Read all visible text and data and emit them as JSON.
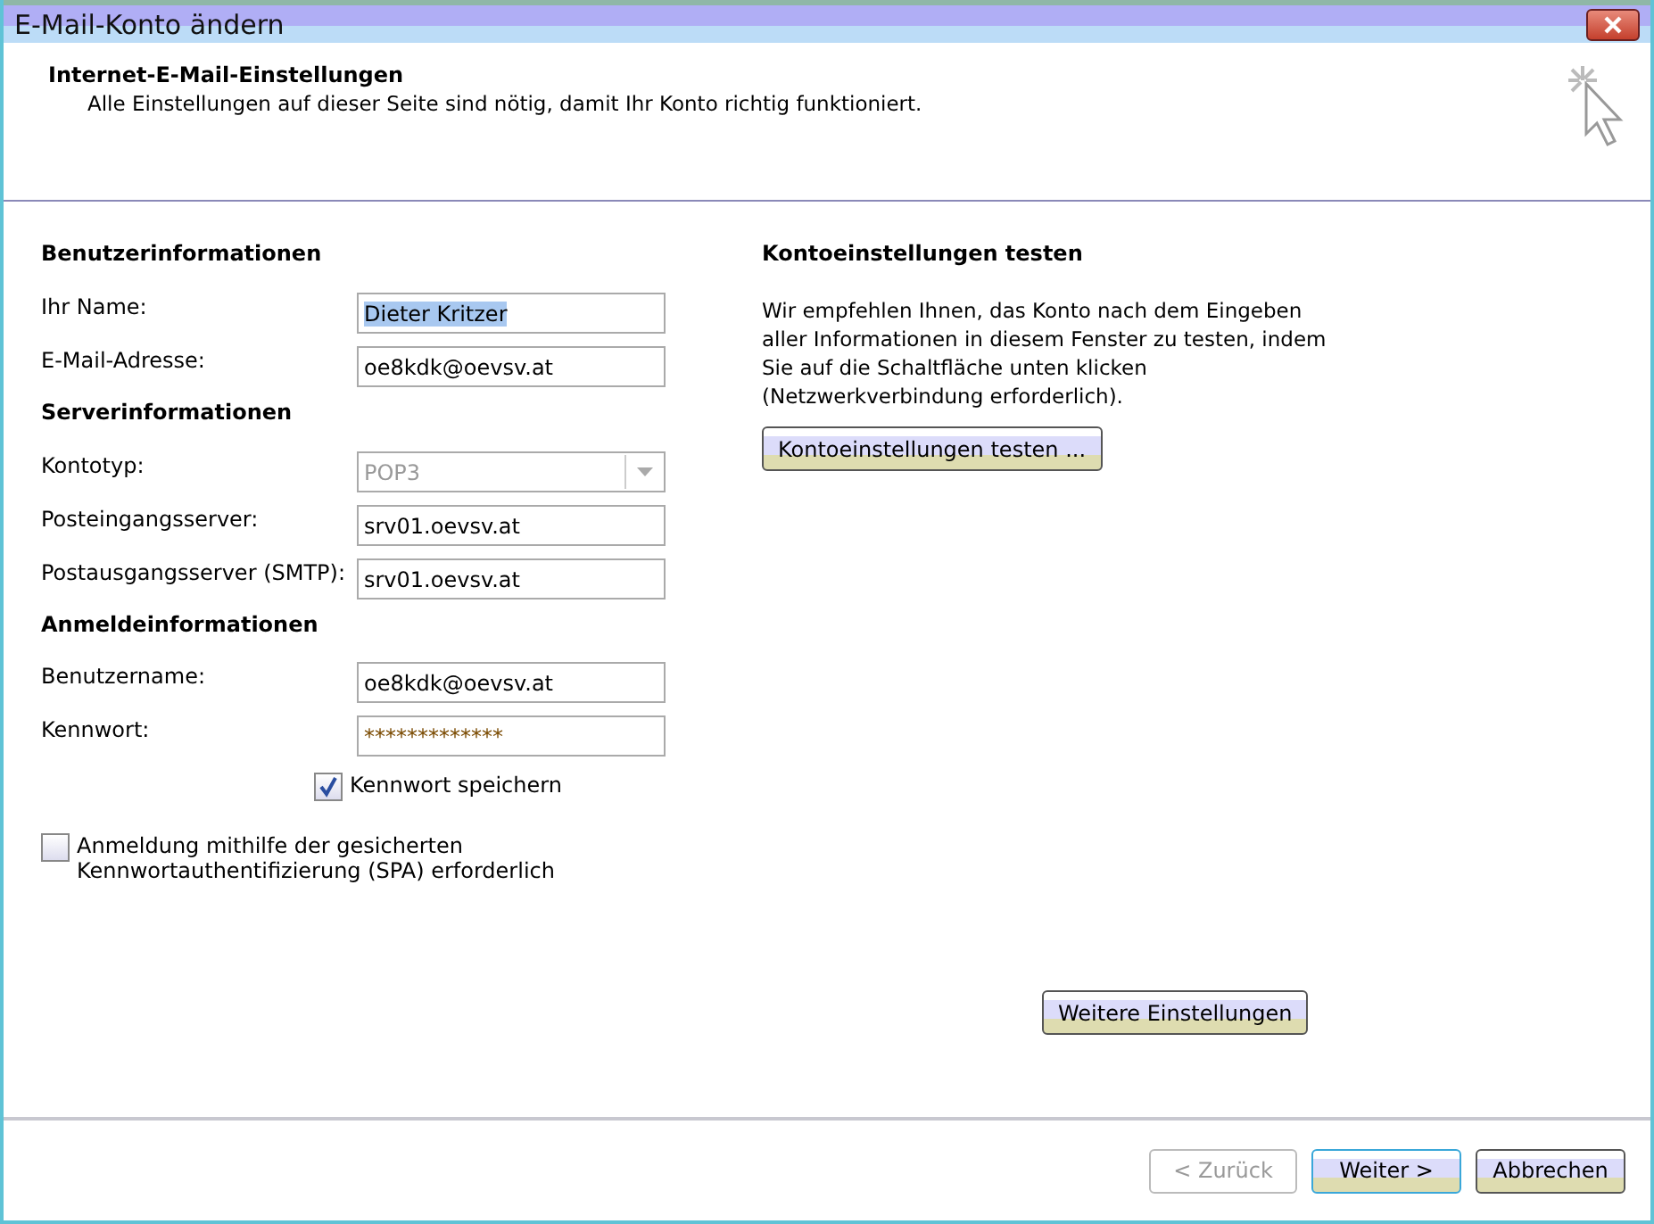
{
  "window": {
    "title": "E-Mail-Konto ändern"
  },
  "header": {
    "title": "Internet-E-Mail-Einstellungen",
    "subtitle": "Alle Einstellungen auf dieser Seite sind nötig, damit Ihr Konto richtig funktioniert."
  },
  "sections": [
    {
      "heading": "Benutzerinformationen",
      "fields": [
        {
          "kind": "text",
          "label": "Ihr Name:",
          "value": "Dieter Kritzer",
          "highlighted": true
        },
        {
          "kind": "text",
          "label": "E-Mail-Adresse:",
          "value": "oe8kdk@oevsv.at",
          "highlighted": false
        }
      ]
    },
    {
      "heading": "Serverinformationen",
      "fields": [
        {
          "kind": "select",
          "label": "Kontotyp:",
          "value": "POP3",
          "disabled": true
        },
        {
          "kind": "text",
          "label": "Posteingangsserver:",
          "value": "srv01.oevsv.at",
          "highlighted": false
        },
        {
          "kind": "text",
          "label": "Postausgangsserver (SMTP):",
          "value": "srv01.oevsv.at",
          "highlighted": false
        }
      ]
    },
    {
      "heading": "Anmeldeinformationen",
      "fields": [
        {
          "kind": "text",
          "label": "Benutzername:",
          "value": "oe8kdk@oevsv.at",
          "highlighted": false
        },
        {
          "kind": "password",
          "label": "Kennwort:",
          "value": "*************"
        }
      ]
    }
  ],
  "save_password": {
    "label": "Kennwort speichern",
    "checked": true
  },
  "spa": {
    "label": "Anmeldung mithilfe der gesicherten Kennwortauthentifizierung (SPA) erforderlich",
    "checked": false
  },
  "test": {
    "heading": "Kontoeinstellungen testen",
    "text": "Wir empfehlen Ihnen, das Konto nach dem Eingeben aller Informationen in diesem Fenster zu testen, indem Sie auf die Schaltfläche unten klicken (Netzwerkverbindung erforderlich).",
    "button": "Kontoeinstellungen testen ..."
  },
  "more_button": "Weitere Einstellungen",
  "buttons": [
    {
      "label": "< Zurück",
      "disabled": true,
      "default": false
    },
    {
      "label": "Weiter >",
      "disabled": false,
      "default": true
    },
    {
      "label": "Abbrechen",
      "disabled": false,
      "default": false
    }
  ]
}
